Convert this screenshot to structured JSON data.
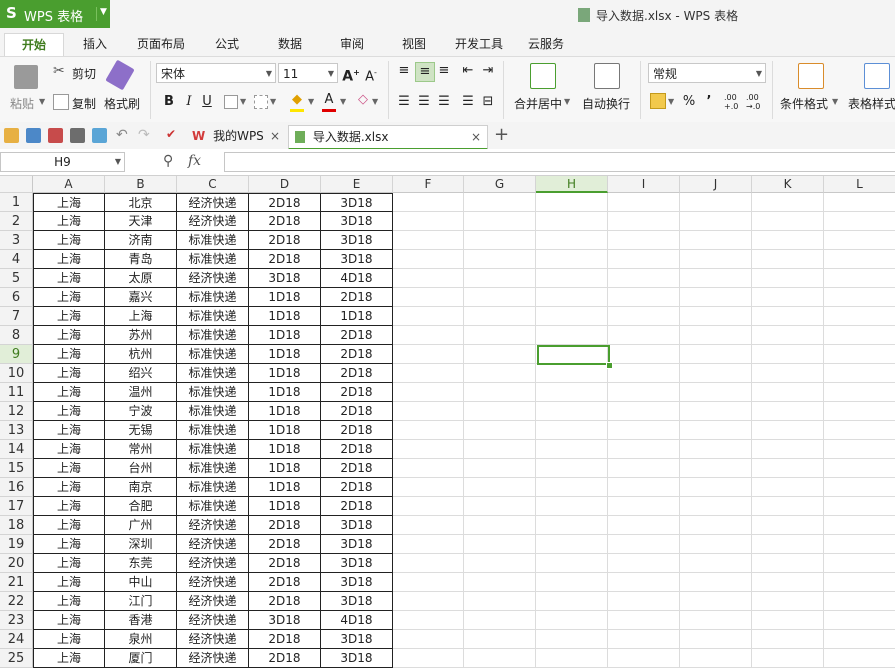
{
  "app": {
    "logo": "S",
    "name": "WPS 表格",
    "window_title": "导入数据.xlsx - WPS 表格"
  },
  "ribbon_tabs": [
    "开始",
    "插入",
    "页面布局",
    "公式",
    "数据",
    "审阅",
    "视图",
    "开发工具",
    "云服务"
  ],
  "ribbon": {
    "paste": "粘贴",
    "cut": "剪切",
    "copy": "复制",
    "format_painter": "格式刷",
    "font_name": "宋体",
    "font_size": "11",
    "merge_center": "合并居中",
    "wrap_text": "自动换行",
    "number_format": "常规",
    "conditional_format": "条件格式",
    "table_style": "表格样式",
    "bold": "B",
    "italic": "I",
    "underline": "U",
    "percent": "%",
    "comma": "’",
    "inc_decimal": ".00 +.0",
    "dec_decimal": ".00 →.0"
  },
  "doc_tabs": [
    {
      "label": "我的WPS",
      "icon": "wps-icon",
      "active": false
    },
    {
      "label": "导入数据.xlsx",
      "icon": "sheet-file-icon",
      "active": true
    }
  ],
  "formula_bar": {
    "name_box": "H9",
    "fx": "fx",
    "formula": ""
  },
  "columns": [
    "A",
    "B",
    "C",
    "D",
    "E",
    "F",
    "G",
    "H",
    "I",
    "J",
    "K",
    "L"
  ],
  "selected": {
    "column": "H",
    "row": 9
  },
  "rows": [
    [
      "上海",
      "北京",
      "经济快递",
      "2D18",
      "3D18"
    ],
    [
      "上海",
      "天津",
      "经济快递",
      "2D18",
      "3D18"
    ],
    [
      "上海",
      "济南",
      "标准快递",
      "2D18",
      "3D18"
    ],
    [
      "上海",
      "青岛",
      "标准快递",
      "2D18",
      "3D18"
    ],
    [
      "上海",
      "太原",
      "经济快递",
      "3D18",
      "4D18"
    ],
    [
      "上海",
      "嘉兴",
      "标准快递",
      "1D18",
      "2D18"
    ],
    [
      "上海",
      "上海",
      "标准快递",
      "1D18",
      "1D18"
    ],
    [
      "上海",
      "苏州",
      "标准快递",
      "1D18",
      "2D18"
    ],
    [
      "上海",
      "杭州",
      "标准快递",
      "1D18",
      "2D18"
    ],
    [
      "上海",
      "绍兴",
      "标准快递",
      "1D18",
      "2D18"
    ],
    [
      "上海",
      "温州",
      "标准快递",
      "1D18",
      "2D18"
    ],
    [
      "上海",
      "宁波",
      "标准快递",
      "1D18",
      "2D18"
    ],
    [
      "上海",
      "无锡",
      "标准快递",
      "1D18",
      "2D18"
    ],
    [
      "上海",
      "常州",
      "标准快递",
      "1D18",
      "2D18"
    ],
    [
      "上海",
      "台州",
      "标准快递",
      "1D18",
      "2D18"
    ],
    [
      "上海",
      "南京",
      "标准快递",
      "1D18",
      "2D18"
    ],
    [
      "上海",
      "合肥",
      "标准快递",
      "1D18",
      "2D18"
    ],
    [
      "上海",
      "广州",
      "经济快递",
      "2D18",
      "3D18"
    ],
    [
      "上海",
      "深圳",
      "经济快递",
      "2D18",
      "3D18"
    ],
    [
      "上海",
      "东莞",
      "经济快递",
      "2D18",
      "3D18"
    ],
    [
      "上海",
      "中山",
      "经济快递",
      "2D18",
      "3D18"
    ],
    [
      "上海",
      "江门",
      "经济快递",
      "2D18",
      "3D18"
    ],
    [
      "上海",
      "香港",
      "经济快递",
      "3D18",
      "4D18"
    ],
    [
      "上海",
      "泉州",
      "经济快递",
      "2D18",
      "3D18"
    ],
    [
      "上海",
      "厦门",
      "经济快递",
      "2D18",
      "3D18"
    ]
  ],
  "colors": {
    "accent": "#4a9e2f",
    "selection_header": "#e1eed8"
  }
}
